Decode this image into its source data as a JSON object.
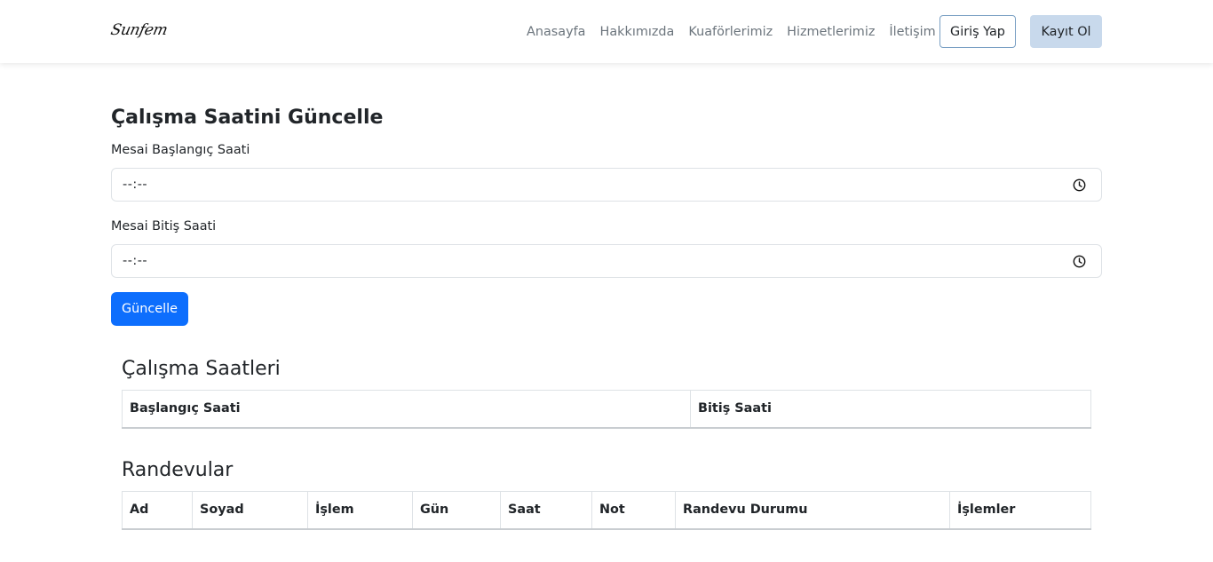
{
  "nav": {
    "logo_text": "Sunfem",
    "links": [
      "Anasayfa",
      "Hakkımızda",
      "Kuaförlerimiz",
      "Hizmetlerimiz",
      "İletişim"
    ],
    "login_label": "Giriş Yap",
    "register_label": "Kayıt Ol"
  },
  "form": {
    "title": "Çalışma Saatini Güncelle",
    "start_label": "Mesai Başlangıç Saati",
    "start_value": "--:--",
    "end_label": "Mesai Bitiş Saati",
    "end_value": "--:--",
    "submit_label": "Güncelle"
  },
  "hours": {
    "title": "Çalışma Saatleri",
    "headers": [
      "Başlangıç Saati",
      "Bitiş Saati"
    ]
  },
  "appointments": {
    "title": "Randevular",
    "headers": [
      "Ad",
      "Soyad",
      "İşlem",
      "Gün",
      "Saat",
      "Not",
      "Randevu Durumu",
      "İşlemler"
    ]
  },
  "icons": {
    "time_picker": "clock-icon"
  },
  "colors": {
    "primary": "#0d6efd",
    "register_bg": "#c8d9ec",
    "login_border": "#7aa0c4"
  }
}
